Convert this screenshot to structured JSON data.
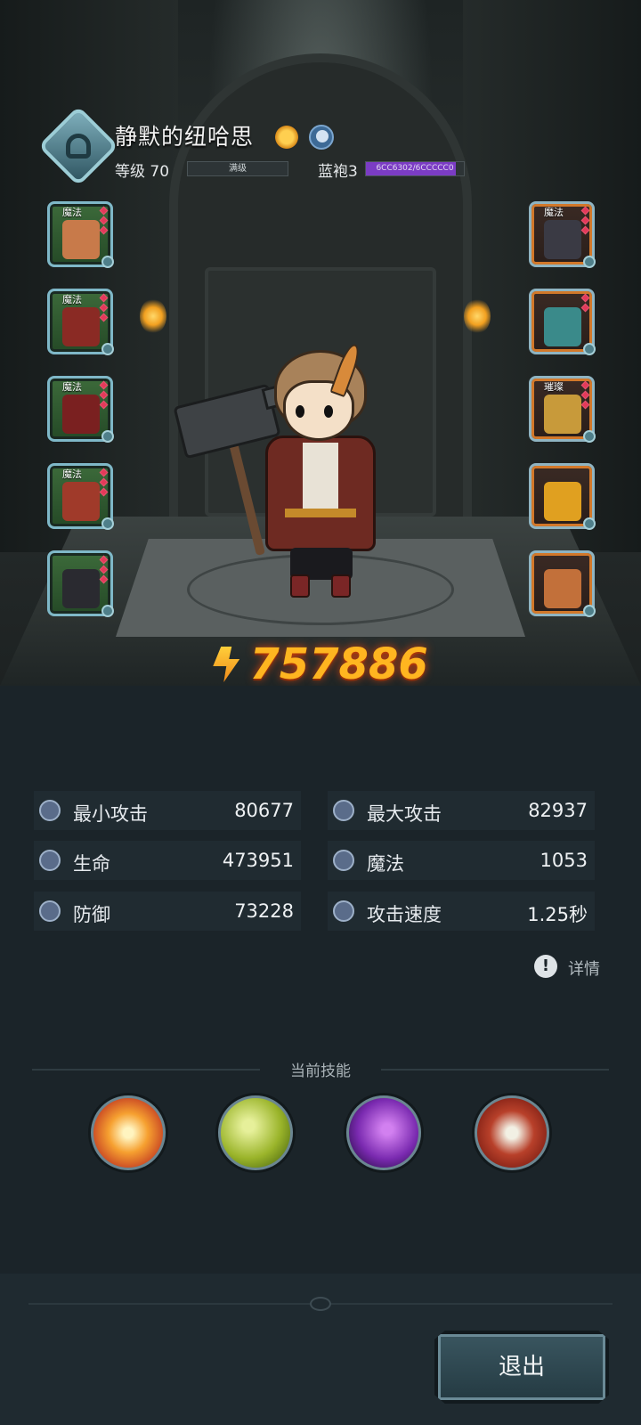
{
  "hero": {
    "name": "静默的纽哈思",
    "level_label": "等级 70",
    "level_bar_text": "满级",
    "rank_label": "蓝袍3",
    "exp_text": "6CC6302/6CCCCC0",
    "exp_progress": 0.92,
    "badges": [
      "sun-element-icon",
      "moon-element-icon"
    ]
  },
  "equipment": {
    "left": [
      {
        "tag": "魔法",
        "item": "hammer-weapon",
        "color": "#c87a4a",
        "gems": 3
      },
      {
        "tag": "魔法",
        "item": "chest-armor",
        "color": "#8a2a24",
        "gems": 3
      },
      {
        "tag": "魔法",
        "item": "leg-armor",
        "color": "#7a2020",
        "gems": 3
      },
      {
        "tag": "魔法",
        "item": "bracers",
        "color": "#a03a2a",
        "gems": 3
      },
      {
        "tag": "",
        "item": "crown-helmet",
        "color": "#2a2a30",
        "gems": 3
      }
    ],
    "right": [
      {
        "tag": "魔法",
        "item": "dark-gauntlet",
        "color": "#3a3a44",
        "gems": 3
      },
      {
        "tag": "",
        "item": "ring",
        "color": "#3a8a8a",
        "gems": 2
      },
      {
        "tag": "璀璨",
        "item": "necklace",
        "color": "#c89a3a",
        "gems": 3
      },
      {
        "tag": "",
        "item": "flame-emblem",
        "color": "#e0a020",
        "gems": 0
      },
      {
        "tag": "",
        "item": "helmet",
        "color": "#c2703a",
        "gems": 0
      }
    ]
  },
  "combat_power": "757886",
  "stats": [
    {
      "icon": "sword-icon",
      "label": "最小攻击",
      "value": "80677"
    },
    {
      "icon": "sword-icon",
      "label": "最大攻击",
      "value": "82937"
    },
    {
      "icon": "heart-icon",
      "label": "生命",
      "value": "473951"
    },
    {
      "icon": "magic-icon",
      "label": "魔法",
      "value": "1053"
    },
    {
      "icon": "shield-icon",
      "label": "防御",
      "value": "73228"
    },
    {
      "icon": "speed-icon",
      "label": "攻击速度",
      "value": "1.25秒"
    }
  ],
  "details_label": "详情",
  "skills_title": "当前技能",
  "skills": [
    "explosion-skill-icon",
    "spores-skill-icon",
    "dark-sword-skill-icon",
    "crossed-axes-skill-icon"
  ],
  "exit_label": "退出"
}
